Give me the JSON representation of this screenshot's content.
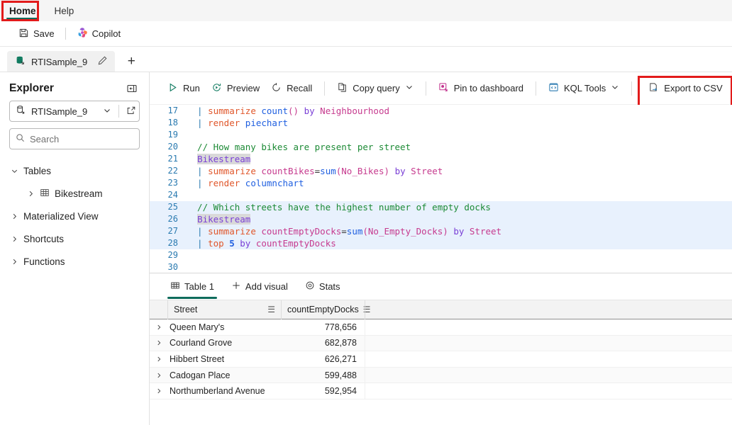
{
  "ribbon": {
    "tabs": [
      {
        "label": "Home",
        "active": true,
        "highlighted": true
      },
      {
        "label": "Help",
        "active": false,
        "highlighted": false
      }
    ],
    "highlight_color": "#e21b1b",
    "accent_color": "#0f6c5c"
  },
  "commandbar": {
    "items": [
      {
        "label": "Save",
        "icon": "save-icon"
      },
      {
        "label": "Copilot",
        "icon": "copilot-icon"
      }
    ]
  },
  "tabstrip": {
    "tab_label": "RTISample_9",
    "tab_icon": "kql-database-icon",
    "rename_icon": "pencil-icon",
    "new_tab_label": "+"
  },
  "explorer": {
    "title": "Explorer",
    "collapse_icon": "collapse-panel-icon",
    "database": {
      "name": "RTISample_9",
      "icon": "database-icon",
      "chevron": "chevron-down-icon",
      "open_icon": "open-in-new-icon"
    },
    "search": {
      "placeholder": "Search",
      "icon": "search-icon"
    },
    "tree": [
      {
        "label": "Tables",
        "level": 1,
        "expanded": true,
        "icon": null
      },
      {
        "label": "Bikestream",
        "level": 2,
        "expanded": false,
        "icon": "table-icon"
      },
      {
        "label": "Materialized View",
        "level": 1,
        "expanded": false,
        "icon": null
      },
      {
        "label": "Shortcuts",
        "level": 1,
        "expanded": false,
        "icon": null
      },
      {
        "label": "Functions",
        "level": 1,
        "expanded": false,
        "icon": null
      }
    ]
  },
  "query_toolbar": {
    "items": [
      {
        "label": "Run",
        "icon": "play-icon",
        "chevron": false
      },
      {
        "label": "Preview",
        "icon": "preview-clock-icon",
        "chevron": false
      },
      {
        "label": "Recall",
        "icon": "recall-icon",
        "chevron": false
      },
      {
        "label": "Copy query",
        "icon": "copy-icon",
        "chevron": true
      },
      {
        "label": "Pin to dashboard",
        "icon": "pin-dashboard-icon",
        "chevron": false
      },
      {
        "label": "KQL Tools",
        "icon": "kql-tools-icon",
        "chevron": true
      },
      {
        "label": "Export to CSV",
        "icon": "export-csv-icon",
        "chevron": false,
        "highlighted": true
      }
    ]
  },
  "editor": {
    "lines": [
      {
        "n": "17",
        "selected": false,
        "tokens": [
          {
            "t": "  | ",
            "c": "tok-op"
          },
          {
            "t": "summarize ",
            "c": "tok-kw"
          },
          {
            "t": "count",
            "c": "tok-fn"
          },
          {
            "t": "() ",
            "c": "tok-paren"
          },
          {
            "t": "by ",
            "c": "tok-by"
          },
          {
            "t": "Neighbourhood",
            "c": "tok-col"
          }
        ]
      },
      {
        "n": "18",
        "selected": false,
        "tokens": [
          {
            "t": "  | ",
            "c": "tok-op"
          },
          {
            "t": "render ",
            "c": "tok-kw"
          },
          {
            "t": "piechart",
            "c": "tok-fn"
          }
        ]
      },
      {
        "n": "19",
        "selected": false,
        "tokens": []
      },
      {
        "n": "20",
        "selected": false,
        "tokens": [
          {
            "t": "  // How many bikes are present per street",
            "c": "tok-cmt"
          }
        ]
      },
      {
        "n": "21",
        "selected": false,
        "tokens": [
          {
            "t": "  ",
            "c": "tok-plain"
          },
          {
            "t": "Bikestream",
            "c": "tok-tbl"
          }
        ]
      },
      {
        "n": "22",
        "selected": false,
        "tokens": [
          {
            "t": "  | ",
            "c": "tok-op"
          },
          {
            "t": "summarize ",
            "c": "tok-kw"
          },
          {
            "t": "countBikes",
            "c": "tok-ident"
          },
          {
            "t": "=",
            "c": "tok-plain"
          },
          {
            "t": "sum",
            "c": "tok-fn"
          },
          {
            "t": "(",
            "c": "tok-paren"
          },
          {
            "t": "No_Bikes",
            "c": "tok-col"
          },
          {
            "t": ") ",
            "c": "tok-paren"
          },
          {
            "t": "by ",
            "c": "tok-by"
          },
          {
            "t": "Street",
            "c": "tok-col"
          }
        ]
      },
      {
        "n": "23",
        "selected": false,
        "tokens": [
          {
            "t": "  | ",
            "c": "tok-op"
          },
          {
            "t": "render ",
            "c": "tok-kw"
          },
          {
            "t": "columnchart",
            "c": "tok-fn"
          }
        ]
      },
      {
        "n": "24",
        "selected": false,
        "tokens": []
      },
      {
        "n": "25",
        "selected": true,
        "tokens": [
          {
            "t": "  // Which streets have the highest number of empty docks",
            "c": "tok-cmt"
          }
        ]
      },
      {
        "n": "26",
        "selected": true,
        "tokens": [
          {
            "t": "  ",
            "c": "tok-plain"
          },
          {
            "t": "Bikestream",
            "c": "tok-tbl"
          }
        ]
      },
      {
        "n": "27",
        "selected": true,
        "tokens": [
          {
            "t": "  | ",
            "c": "tok-op"
          },
          {
            "t": "summarize ",
            "c": "tok-kw"
          },
          {
            "t": "countEmptyDocks",
            "c": "tok-ident"
          },
          {
            "t": "=",
            "c": "tok-plain"
          },
          {
            "t": "sum",
            "c": "tok-fn"
          },
          {
            "t": "(",
            "c": "tok-paren"
          },
          {
            "t": "No_Empty_Docks",
            "c": "tok-col"
          },
          {
            "t": ") ",
            "c": "tok-paren"
          },
          {
            "t": "by ",
            "c": "tok-by"
          },
          {
            "t": "Street",
            "c": "tok-col"
          }
        ]
      },
      {
        "n": "28",
        "selected": true,
        "tokens": [
          {
            "t": "  | ",
            "c": "tok-op"
          },
          {
            "t": "top ",
            "c": "tok-kw"
          },
          {
            "t": "5 ",
            "c": "tok-num"
          },
          {
            "t": "by ",
            "c": "tok-by"
          },
          {
            "t": "countEmptyDocks",
            "c": "tok-ident"
          }
        ]
      },
      {
        "n": "29",
        "selected": false,
        "tokens": []
      },
      {
        "n": "30",
        "selected": false,
        "tokens": []
      }
    ]
  },
  "results": {
    "tabs": [
      {
        "label": "Table 1",
        "icon": "table-grid-icon",
        "active": true
      },
      {
        "label": "Add visual",
        "icon": "plus-icon",
        "active": false
      },
      {
        "label": "Stats",
        "icon": "stats-target-icon",
        "active": false
      }
    ],
    "columns": [
      {
        "label": "Street",
        "menu_icon": "column-menu-icon"
      },
      {
        "label": "countEmptyDocks",
        "menu_icon": "column-menu-icon"
      }
    ],
    "rows": [
      {
        "expand_icon": "chevron-right-icon",
        "street": "Queen Mary's",
        "countEmptyDocks": "778,656"
      },
      {
        "expand_icon": "chevron-right-icon",
        "street": "Courland Grove",
        "countEmptyDocks": "682,878"
      },
      {
        "expand_icon": "chevron-right-icon",
        "street": "Hibbert Street",
        "countEmptyDocks": "626,271"
      },
      {
        "expand_icon": "chevron-right-icon",
        "street": "Cadogan Place",
        "countEmptyDocks": "599,488"
      },
      {
        "expand_icon": "chevron-right-icon",
        "street": "Northumberland Avenue",
        "countEmptyDocks": "592,954"
      }
    ]
  }
}
